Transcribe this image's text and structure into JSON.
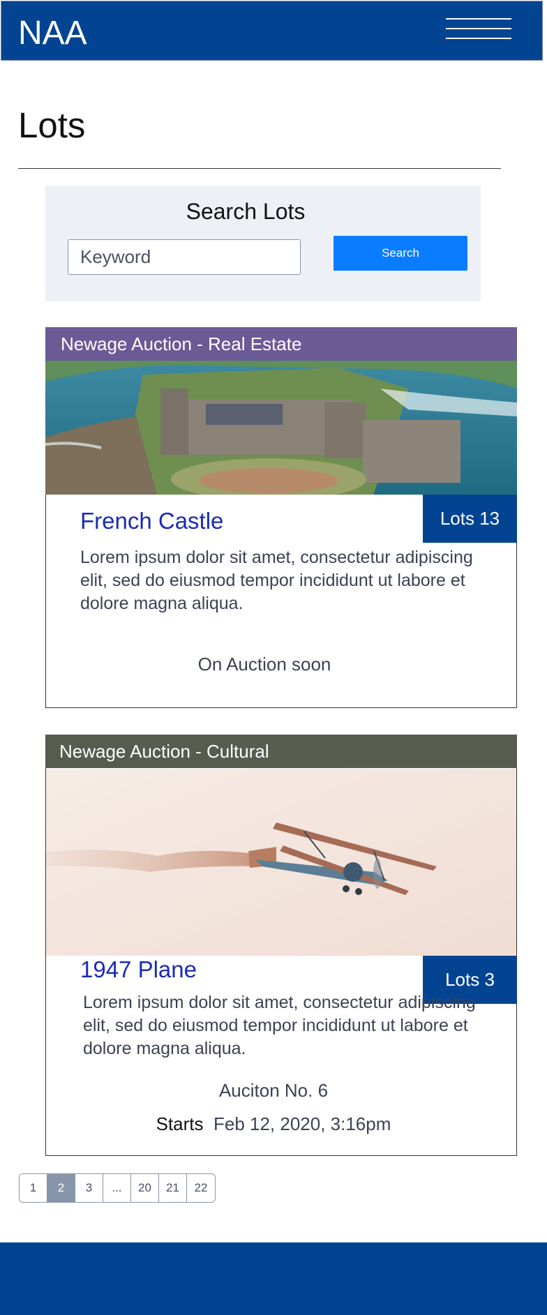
{
  "header": {
    "brand": "NAA",
    "menu_icon": "hamburger-menu-icon"
  },
  "page": {
    "title": "Lots"
  },
  "search": {
    "title": "Search Lots",
    "placeholder": "Keyword",
    "button_label": "Search"
  },
  "lots": [
    {
      "category": "Newage Auction - Real Estate",
      "category_color": "#6a5a95",
      "image": "castle-photo",
      "title": "French Castle",
      "badge": "Lots 13",
      "description": "Lorem ipsum dolor sit amet, consectetur adipiscing elit, sed do eiusmod tempor incididunt ut labore et dolore magna aliqua.",
      "status": "On Auction soon"
    },
    {
      "category": "Newage Auction - Cultural",
      "category_color": "#565d4f",
      "image": "biplane-photo",
      "title": "1947 Plane",
      "badge": "Lots 3",
      "description": "Lorem ipsum dolor sit amet, consectetur adipiscing elit, sed do eiusmod tempor incididunt ut labore et dolore magna aliqua.",
      "auction_no": "Auciton No. 6",
      "starts_label": "Starts",
      "starts_value": "Feb 12, 2020, 3:16pm"
    }
  ],
  "pagination": {
    "pages": [
      "1",
      "2",
      "3",
      "...",
      "20",
      "21",
      "22"
    ],
    "current": "2"
  },
  "colors": {
    "brand": "#034492",
    "accent": "#0a7cff",
    "title_link": "#1a2bb5"
  }
}
